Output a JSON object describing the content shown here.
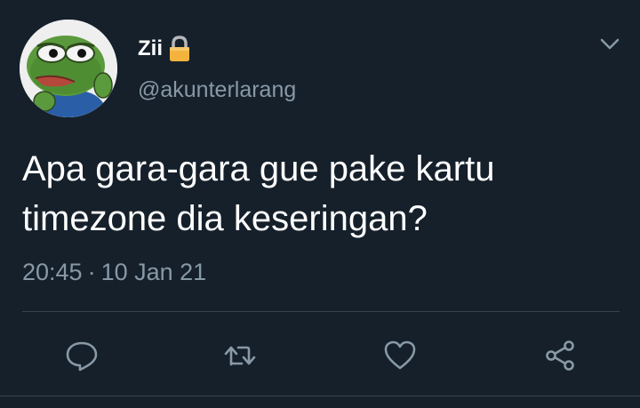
{
  "colors": {
    "background": "#15202b",
    "text_primary": "#ffffff",
    "text_secondary": "#8899a6",
    "divider": "#38444d",
    "icon": "#8899a6"
  },
  "user": {
    "display_name": "Zii",
    "handle": "@akunterlarang",
    "avatar": "frog-avatar",
    "lock_icon": "lock-icon"
  },
  "tweet": {
    "text": "Apa gara-gara gue pake kartu\ntimezone dia keseringan?",
    "time": "20:45",
    "separator": "·",
    "date": "10 Jan 21"
  },
  "actions": [
    {
      "icon": "reply-icon"
    },
    {
      "icon": "retweet-icon"
    },
    {
      "icon": "like-icon"
    },
    {
      "icon": "share-icon"
    }
  ],
  "menu": {
    "icon": "chevron-down-icon"
  }
}
